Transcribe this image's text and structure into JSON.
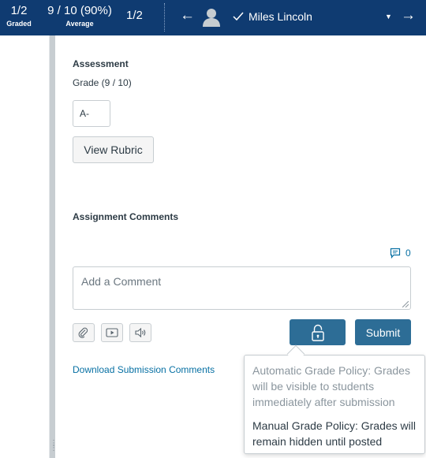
{
  "header": {
    "graded": {
      "value": "1/2",
      "label": "Graded"
    },
    "average": {
      "value": "9 / 10 (90%)",
      "label": "Average"
    },
    "student_count": "1/2",
    "prev_icon": "arrow-left-icon",
    "next_icon": "arrow-right-icon",
    "student_name": "Miles Lincoln",
    "status_icon": "check-icon",
    "dropdown_icon": "caret-down-icon"
  },
  "assessment": {
    "title": "Assessment",
    "grade_label": "Grade (9 / 10)",
    "grade_value": "A-",
    "rubric_button": "View Rubric"
  },
  "comments": {
    "title": "Assignment Comments",
    "count": "0",
    "placeholder": "Add a Comment",
    "submit_label": "Submit",
    "download_link": "Download Submission Comments",
    "media_icons": [
      "paperclip-icon",
      "video-icon",
      "audio-icon"
    ]
  },
  "tooltip": {
    "automatic": "Automatic Grade Policy: Grades will be visible to students immediately after submission",
    "manual": "Manual Grade Policy: Grades will remain hidden until posted"
  },
  "colors": {
    "header_bg": "#0f3b71",
    "primary_button": "#2d6d96",
    "link": "#0770a3"
  }
}
